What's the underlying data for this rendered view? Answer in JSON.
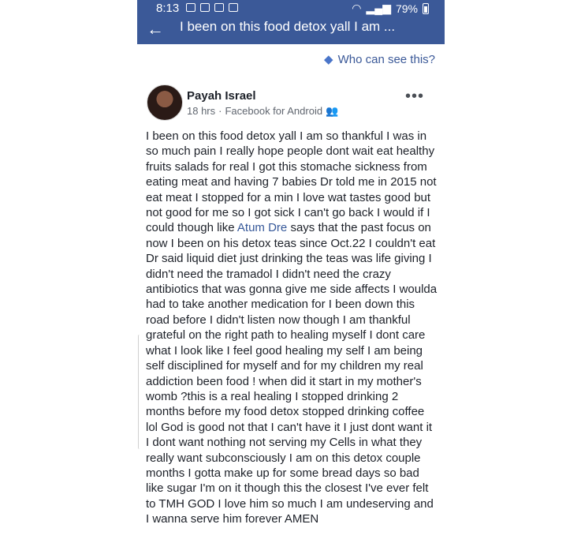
{
  "status_bar": {
    "time": "8:13",
    "battery": "79%"
  },
  "nav": {
    "title": "I been on this food detox yall I am ..."
  },
  "privacy": {
    "label": "Who can see this?"
  },
  "post": {
    "author": "Payah Israel",
    "time": "18 hrs",
    "separator": "·",
    "source": "Facebook for Android",
    "text_part1": "I been on this food detox yall I am so thankful I was in so much pain I really hope people dont wait eat healthy fruits salads for real I got this stomache sickness from eating meat and having 7 babies Dr told me in 2015 not eat meat I stopped for a min I love wat tastes good but not good for me so I got sick I can't go back I would if I could though like ",
    "mention": "Atum Dre",
    "text_part2": " says that the past focus on now I been on his detox teas since Oct.22 I couldn't eat Dr said liquid diet just drinking the teas was life giving I didn't need the tramadol I didn't need the crazy antibiotics that was gonna give me side affects I woulda had to take another medication for I been down this road before I didn't listen now though I am thankful grateful on the right path to healing myself I dont care what I look like I feel good healing my self I am being self disciplined for myself and for my children my real addiction been food ! when did it start in my mother's womb ?this is a real healing I stopped drinking 2 months before my food detox stopped drinking coffee lol God is good not that I can't have it I just dont want it I dont want nothing not serving my Cells in what they really want subconsciously I am on this detox couple months I gotta make up for some bread days so bad like sugar I'm on it though this the closest I've ever felt to TMH GOD I love him so much I am undeserving and I wanna serve him forever AMEN"
  },
  "icons": [
    "back-arrow-icon",
    "tag-icon",
    "friends-icon",
    "more-options-icon",
    "wifi-icon",
    "signal-icon",
    "battery-icon"
  ]
}
